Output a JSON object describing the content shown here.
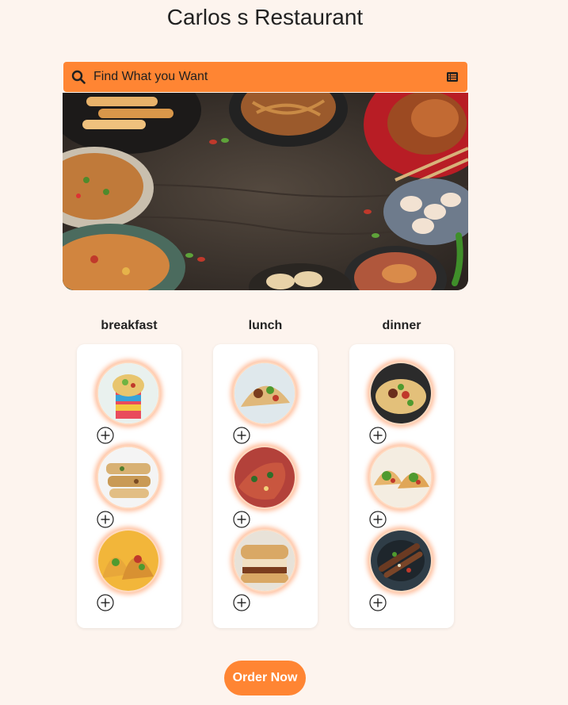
{
  "page": {
    "title": "Carlos s Restaurant"
  },
  "search": {
    "placeholder": "Find What you Want",
    "icon": "search-icon",
    "menu_icon": "list-icon"
  },
  "hero": {
    "image": "food-table-banner"
  },
  "columns": [
    {
      "title": "breakfast",
      "items": [
        {
          "image": "breakfast-dish-1",
          "action": "add-icon"
        },
        {
          "image": "breakfast-dish-2",
          "action": "add-icon"
        },
        {
          "image": "breakfast-dish-3",
          "action": "add-icon"
        }
      ]
    },
    {
      "title": "lunch",
      "items": [
        {
          "image": "lunch-dish-1",
          "action": "add-icon"
        },
        {
          "image": "lunch-dish-2",
          "action": "add-icon"
        },
        {
          "image": "lunch-dish-3",
          "action": "add-icon"
        }
      ]
    },
    {
      "title": "dinner",
      "items": [
        {
          "image": "dinner-dish-1",
          "action": "add-icon"
        },
        {
          "image": "dinner-dish-2",
          "action": "add-icon"
        },
        {
          "image": "dinner-dish-3",
          "action": "add-icon"
        }
      ]
    }
  ],
  "order": {
    "label": "Order Now"
  },
  "colors": {
    "accent": "#ff8533",
    "background": "#fdf4ee",
    "card": "#ffffff"
  }
}
